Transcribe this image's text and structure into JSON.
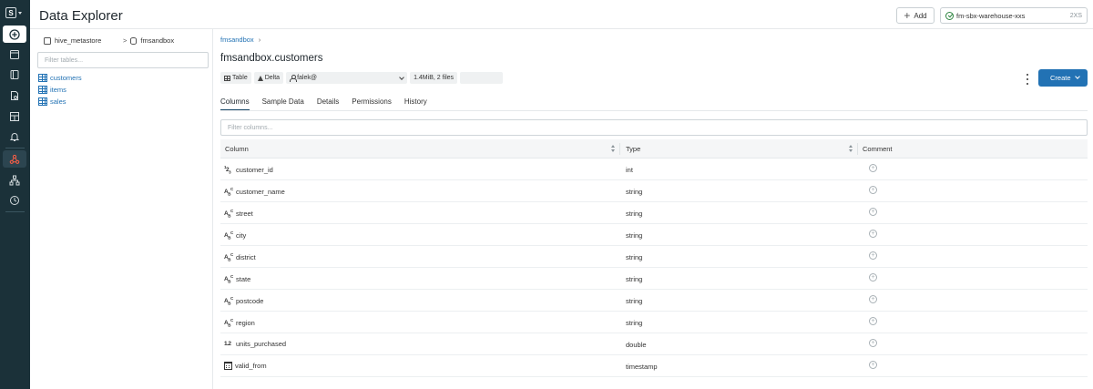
{
  "app": {
    "logo_letter": "S",
    "title": "Data Explorer"
  },
  "rail": {
    "items": [
      {
        "icon": "plus-circle-icon"
      },
      {
        "icon": "sql-editor-icon"
      },
      {
        "icon": "notebook-icon"
      },
      {
        "icon": "queries-icon"
      },
      {
        "icon": "dashboards-icon"
      },
      {
        "icon": "alerts-icon"
      },
      {
        "icon": "data-icon"
      },
      {
        "icon": "endpoints-icon"
      },
      {
        "icon": "history-icon"
      }
    ]
  },
  "header": {
    "add_label": "Add",
    "warehouse_name": "fm-sbx-warehouse-xxs",
    "warehouse_size": "2XS"
  },
  "tree": {
    "catalog": "hive_metastore",
    "schema": "fmsandbox",
    "filter_placeholder": "Filter tables...",
    "tables": [
      "customers",
      "items",
      "sales"
    ]
  },
  "main": {
    "breadcrumb": "fmsandbox",
    "table_title": "fmsandbox.customers",
    "chips": {
      "type": "Table",
      "format": "Delta",
      "owner": "falek@",
      "size": "1.4MiB, 2 files"
    },
    "create_label": "Create",
    "tabs": [
      "Columns",
      "Sample Data",
      "Details",
      "Permissions",
      "History"
    ],
    "active_tab": "Columns",
    "filter_columns_placeholder": "Filter columns...",
    "grid_headers": [
      "Column",
      "Type",
      "Comment"
    ],
    "columns": [
      {
        "name": "customer_id",
        "type": "int",
        "glyph": "123"
      },
      {
        "name": "customer_name",
        "type": "string",
        "glyph": "ABC"
      },
      {
        "name": "street",
        "type": "string",
        "glyph": "ABC"
      },
      {
        "name": "city",
        "type": "string",
        "glyph": "ABC"
      },
      {
        "name": "district",
        "type": "string",
        "glyph": "ABC"
      },
      {
        "name": "state",
        "type": "string",
        "glyph": "ABC"
      },
      {
        "name": "postcode",
        "type": "string",
        "glyph": "ABC"
      },
      {
        "name": "region",
        "type": "string",
        "glyph": "ABC"
      },
      {
        "name": "units_purchased",
        "type": "double",
        "glyph": "1.2"
      },
      {
        "name": "valid_from",
        "type": "timestamp",
        "glyph": "calendar"
      }
    ]
  },
  "colors": {
    "rail_bg": "#1b3139",
    "accent": "#2272b4"
  }
}
